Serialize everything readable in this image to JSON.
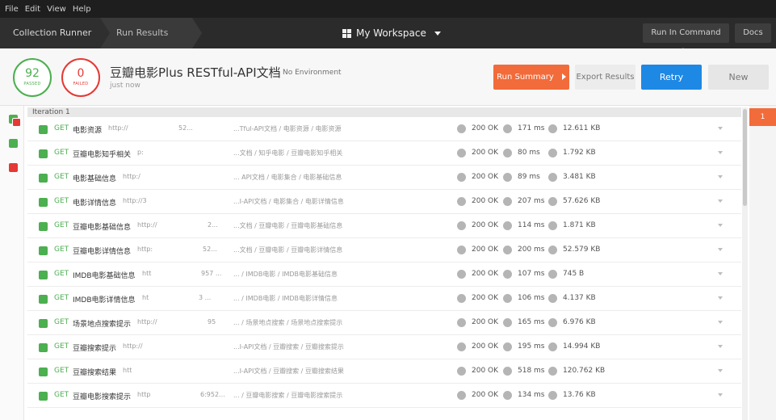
{
  "menu": [
    "File",
    "Edit",
    "View",
    "Help"
  ],
  "breadcrumbs": {
    "runner": "Collection Runner",
    "results": "Run Results"
  },
  "workspace": "My Workspace",
  "top_buttons": {
    "cli": "Run In Command Line",
    "docs": "Docs"
  },
  "summary": {
    "passed": "92",
    "passed_label": "PASSED",
    "failed": "0",
    "failed_label": "FAILED",
    "collection": "豆瓣电影Plus RESTful-API文档",
    "environment": "No Environment",
    "time": "just now"
  },
  "actions": {
    "run_summary": "Run Summary",
    "export": "Export Results",
    "retry": "Retry",
    "new": "New"
  },
  "iteration": {
    "label": "Iteration 1",
    "tab": "1"
  },
  "colors": {
    "pass": "#4caf50",
    "fail": "#e53935",
    "accent": "#f26b3a",
    "primary": "#1e88e5"
  },
  "requests": [
    {
      "method": "GET",
      "name": "电影资源",
      "url": "http://",
      "url_tail": "52...",
      "path": "...Tful-API文档 / 电影资源 / 电影资源",
      "status": "200 OK",
      "time": "171 ms",
      "size": "12.611 KB"
    },
    {
      "method": "GET",
      "name": "豆瓣电影知乎相关",
      "url": "p:",
      "url_tail": "",
      "path": "...文档 / 知乎电影 / 豆瓣电影知乎相关",
      "status": "200 OK",
      "time": "80 ms",
      "size": "1.792 KB"
    },
    {
      "method": "GET",
      "name": "电影基础信息",
      "url": "http:/",
      "url_tail": "",
      "path": "... API文档 / 电影集合 / 电影基础信息",
      "status": "200 OK",
      "time": "89 ms",
      "size": "3.481 KB"
    },
    {
      "method": "GET",
      "name": "电影详情信息",
      "url": "http://3",
      "url_tail": "",
      "path": "...I-API文档 / 电影集合 / 电影详情信息",
      "status": "200 OK",
      "time": "207 ms",
      "size": "57.626 KB"
    },
    {
      "method": "GET",
      "name": "豆瓣电影基础信息",
      "url": "http://",
      "url_tail": "2...",
      "path": "...文档 / 豆瓣电影 / 豆瓣电影基础信息",
      "status": "200 OK",
      "time": "114 ms",
      "size": "1.871 KB"
    },
    {
      "method": "GET",
      "name": "豆瓣电影详情信息",
      "url": "http:",
      "url_tail": "52...",
      "path": "...文档 / 豆瓣电影 / 豆瓣电影详情信息",
      "status": "200 OK",
      "time": "200 ms",
      "size": "52.579 KB"
    },
    {
      "method": "GET",
      "name": "IMDB电影基础信息",
      "url": "htt",
      "url_tail": "957 ...",
      "path": "... / IMDB电影 / IMDB电影基础信息",
      "status": "200 OK",
      "time": "107 ms",
      "size": "745 B"
    },
    {
      "method": "GET",
      "name": "IMDB电影详情信息",
      "url": "ht",
      "url_tail": "3 ...",
      "path": "... / IMDB电影 / IMDB电影详情信息",
      "status": "200 OK",
      "time": "106 ms",
      "size": "4.137 KB"
    },
    {
      "method": "GET",
      "name": "场景地点搜索提示",
      "url": "http://",
      "url_tail": "95",
      "path": "... / 场景地点搜索 / 场景地点搜索提示",
      "status": "200 OK",
      "time": "165 ms",
      "size": "6.976 KB"
    },
    {
      "method": "GET",
      "name": "豆瓣搜索提示",
      "url": "http://",
      "url_tail": "",
      "path": "...I-API文档 / 豆瓣搜索 / 豆瓣搜索提示",
      "status": "200 OK",
      "time": "195 ms",
      "size": "14.994 KB"
    },
    {
      "method": "GET",
      "name": "豆瓣搜索结果",
      "url": "htt",
      "url_tail": "",
      "path": "...I-API文档 / 豆瓣搜索 / 豆瓣搜索结果",
      "status": "200 OK",
      "time": "518 ms",
      "size": "120.762 KB"
    },
    {
      "method": "GET",
      "name": "豆瓣电影搜索提示",
      "url": "http",
      "url_tail": "6:952...",
      "path": "... / 豆瓣电影搜索 / 豆瓣电影搜索提示",
      "status": "200 OK",
      "time": "134 ms",
      "size": "13.76 KB"
    }
  ]
}
